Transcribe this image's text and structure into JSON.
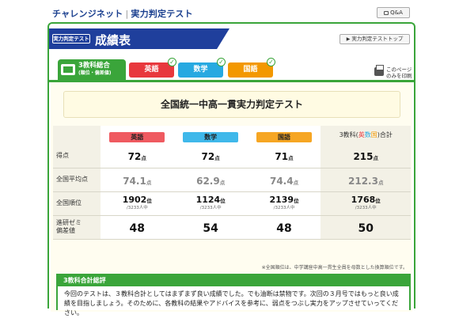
{
  "header": {
    "brand": "チャレンジネット",
    "sub": "実力判定テスト",
    "qa": "Q&A"
  },
  "title": {
    "tag": "実力判定テスト",
    "text": "成績表",
    "toplink": "実力判定テストトップ"
  },
  "tabs": {
    "total_line1": "3教科総合",
    "total_line2": "(順位・偏差値)",
    "english": "英語",
    "math": "数学",
    "japanese": "国語",
    "print_line1": "このページ",
    "print_line2": "のみを印刷"
  },
  "banner": "全国統一中高一貫実力判定テスト",
  "table": {
    "headers": {
      "english": "英語",
      "math": "数学",
      "japanese": "国語",
      "total_pre": "3教科(",
      "total_en": "英",
      "total_ma": "数",
      "total_ja": "国",
      "total_post": ")合計"
    },
    "rows": {
      "score": {
        "label": "得点",
        "unit": "点",
        "english": "72",
        "math": "72",
        "japanese": "71",
        "total": "215"
      },
      "avg": {
        "label": "全国平均点",
        "unit": "点",
        "english": "74.1",
        "math": "62.9",
        "japanese": "74.4",
        "total": "212.3"
      },
      "rank": {
        "label": "全国順位",
        "unit": "位",
        "of": "/3233人中",
        "english": "1902",
        "math": "1124",
        "japanese": "2139",
        "total": "1768"
      },
      "dev": {
        "label1": "進研ゼミ",
        "label2": "偏差値",
        "english": "48",
        "math": "54",
        "japanese": "48",
        "total": "50"
      }
    }
  },
  "note": "※全国順位は、中学講座中高一貫生全員を母数とした換算順位です。",
  "review": {
    "head": "3教科合計総評",
    "text": "今回のテストは、３教科合計としてはまずまず良い成績でした。でも油断は禁物です。次回の３月号ではもっと良い成績を目指しましょう。そのために、各教科の結果やアドバイスを参考に、弱点をつぶし実力をアップさせていってください。"
  },
  "colors": {
    "green": "#3aa53a",
    "navy": "#1f3f9c",
    "english": "#e8383d",
    "math": "#27a9e1",
    "japanese": "#f39800"
  }
}
